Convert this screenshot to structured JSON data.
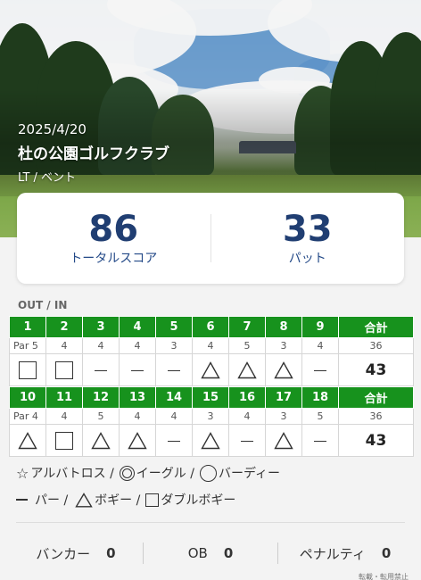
{
  "round": {
    "date": "2025/4/20",
    "course": "杜の公園ゴルフクラブ",
    "tee": "LT / ベント"
  },
  "summary": {
    "total": "86",
    "total_label": "トータルスコア",
    "putts": "33",
    "putts_label": "パット"
  },
  "section_label": "OUT / IN",
  "out": {
    "holes": [
      "1",
      "2",
      "3",
      "4",
      "5",
      "6",
      "7",
      "8",
      "9"
    ],
    "total_label": "合計",
    "par_prefix": "Par 5",
    "pars": [
      "5",
      "4",
      "4",
      "4",
      "3",
      "4",
      "5",
      "3",
      "4"
    ],
    "par_total": "36",
    "results": [
      "double-bogey",
      "double-bogey",
      "par",
      "par",
      "par",
      "bogey",
      "bogey",
      "bogey",
      "par"
    ],
    "score_total": "43"
  },
  "in": {
    "holes": [
      "10",
      "11",
      "12",
      "13",
      "14",
      "15",
      "16",
      "17",
      "18"
    ],
    "total_label": "合計",
    "par_prefix": "Par 4",
    "pars": [
      "4",
      "4",
      "5",
      "4",
      "4",
      "3",
      "4",
      "3",
      "5"
    ],
    "par_total": "36",
    "results": [
      "bogey",
      "double-bogey",
      "bogey",
      "bogey",
      "par",
      "bogey",
      "par",
      "bogey",
      "par"
    ],
    "score_total": "43"
  },
  "legend": {
    "albatross": "アルバトロス /",
    "eagle": "イーグル /",
    "birdie": "バーディー",
    "par": "パー /",
    "bogey": "ボギー /",
    "double_bogey": "ダブルボギー"
  },
  "stats": {
    "bunker_label": "バンカー",
    "bunker": "0",
    "ob_label": "OB",
    "ob": "0",
    "penalty_label": "ペナルティ",
    "penalty": "0"
  },
  "footer": "転載・転用禁止",
  "colors": {
    "header_green": "#17921d",
    "score_navy": "#203e72"
  }
}
